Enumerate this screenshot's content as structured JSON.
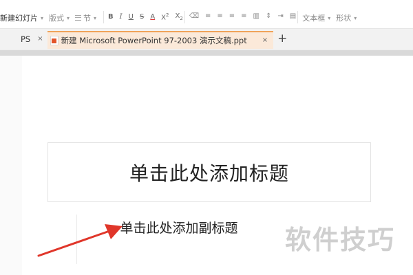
{
  "ribbon": {
    "new_slide": "新建幻灯片",
    "layout": "版式",
    "section": "节",
    "bold": "B",
    "italic": "I",
    "underline": "U",
    "strike": "S",
    "font_color": "A",
    "superscript": "X",
    "sup_mark": "2",
    "subscript": "X",
    "sub_mark": "2",
    "text_box": "文本框",
    "shape": "形状"
  },
  "tabs": {
    "wps": "PS",
    "doc": "新建 Microsoft PowerPoint 97-2003 演示文稿.ppt",
    "close": "×",
    "add": "+"
  },
  "slide": {
    "title_placeholder": "单击此处添加标题",
    "subtitle_placeholder": "单击此处添加副标题"
  },
  "watermark": "软件技巧",
  "colors": {
    "accent_tab": "#fbe9d9",
    "tab_border": "#f0a35a",
    "arrow": "#e0362a"
  }
}
